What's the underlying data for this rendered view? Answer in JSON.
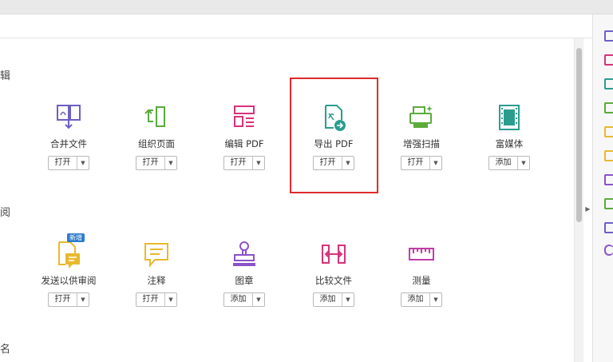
{
  "sections": [
    {
      "char": "辑"
    },
    {
      "char": "阅"
    },
    {
      "char": "名"
    }
  ],
  "tools": [
    {
      "label": "合并文件",
      "action": "打开",
      "icon": "combine-files-icon"
    },
    {
      "label": "组织页面",
      "action": "打开",
      "icon": "organize-pages-icon"
    },
    {
      "label": "编辑 PDF",
      "action": "打开",
      "icon": "edit-pdf-icon"
    },
    {
      "label": "导出 PDF",
      "action": "打开",
      "icon": "export-pdf-icon"
    },
    {
      "label": "增强扫描",
      "action": "打开",
      "icon": "enhance-scan-icon"
    },
    {
      "label": "富媒体",
      "action": "添加",
      "icon": "rich-media-icon"
    },
    {
      "label": "发送以供审阅",
      "action": "打开",
      "icon": "send-for-review-icon",
      "badge": "新增"
    },
    {
      "label": "注释",
      "action": "打开",
      "icon": "comment-icon"
    },
    {
      "label": "图章",
      "action": "添加",
      "icon": "stamp-icon"
    },
    {
      "label": "比较文件",
      "action": "添加",
      "icon": "compare-files-icon"
    },
    {
      "label": "测量",
      "action": "添加",
      "icon": "measure-icon"
    }
  ],
  "colors": {
    "highlight": "#e02b2b",
    "purple": "#6c5fc7",
    "green": "#5aab3c",
    "pink": "#d8327b",
    "teal": "#2a9d8f",
    "yellow": "#e8b92e",
    "badge": "#2e7bcf"
  },
  "dropdown_glyph": "▼",
  "collapse_glyph": "▶"
}
